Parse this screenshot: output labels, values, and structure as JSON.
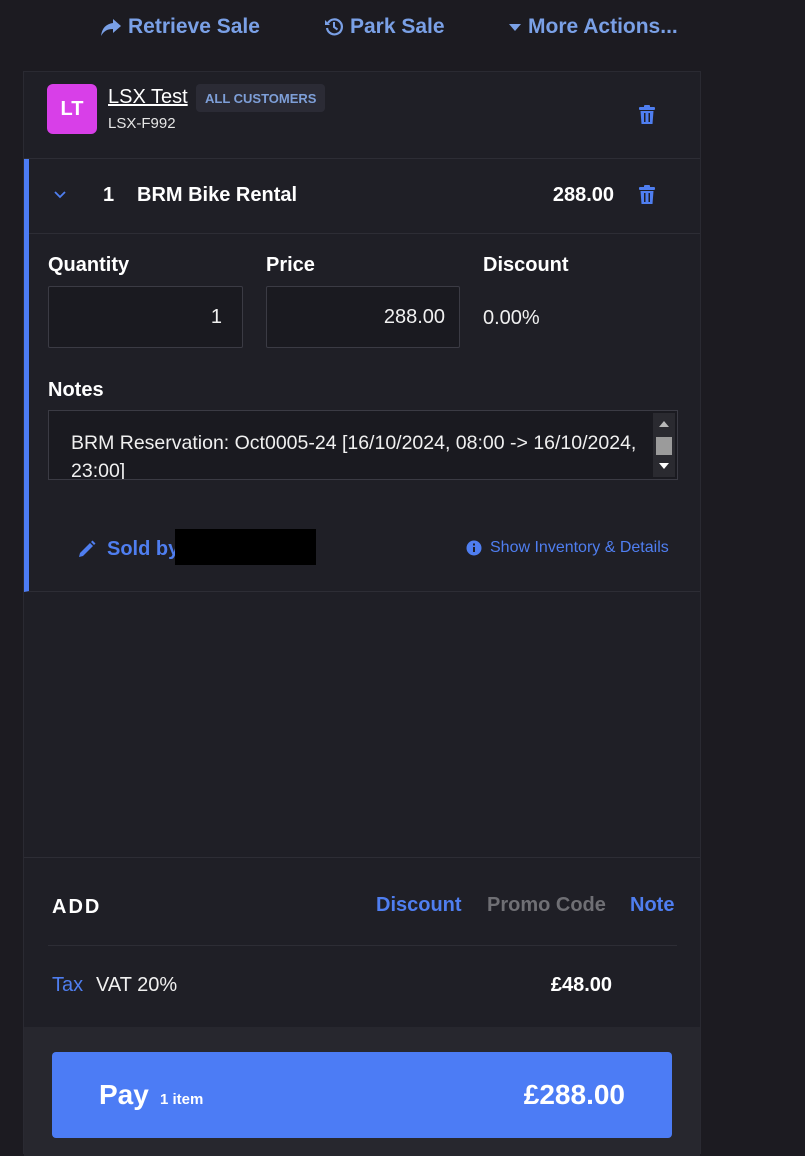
{
  "top_actions": {
    "retrieve_label": "Retrieve Sale",
    "park_label": "Park Sale",
    "more_label": "More Actions..."
  },
  "customer": {
    "initials": "LT",
    "name": "LSX Test",
    "code": "LSX-F992",
    "group_badge": "ALL CUSTOMERS",
    "avatar_color": "#d83fe8"
  },
  "line_item": {
    "quantity": "1",
    "name": "BRM Bike Rental",
    "line_total": "288.00",
    "fields": {
      "quantity_label": "Quantity",
      "quantity_value": "1",
      "price_label": "Price",
      "price_value": "288.00",
      "discount_label": "Discount",
      "discount_value": "0.00%"
    },
    "notes_label": "Notes",
    "notes_value": "BRM Reservation: Oct0005-24 [16/10/2024, 08:00 -> 16/10/2024, 23:00]",
    "sold_by_label": "Sold by",
    "show_inventory_label": "Show Inventory & Details"
  },
  "add_section": {
    "label": "ADD",
    "discount_link": "Discount",
    "promo_link": "Promo Code",
    "note_link": "Note"
  },
  "tax": {
    "label": "Tax",
    "name": "VAT 20%",
    "amount": "£48.00"
  },
  "pay": {
    "label": "Pay",
    "item_count": "1 item",
    "total": "£288.00"
  },
  "colors": {
    "accent": "#4c7cf5",
    "link": "#4f7ef0",
    "background": "#1c1b21",
    "panel": "#1f1f26"
  },
  "icons": [
    "share-arrow-icon",
    "history-icon",
    "caret-down-icon",
    "trash-icon",
    "chevron-down-icon",
    "pencil-icon",
    "info-icon"
  ]
}
